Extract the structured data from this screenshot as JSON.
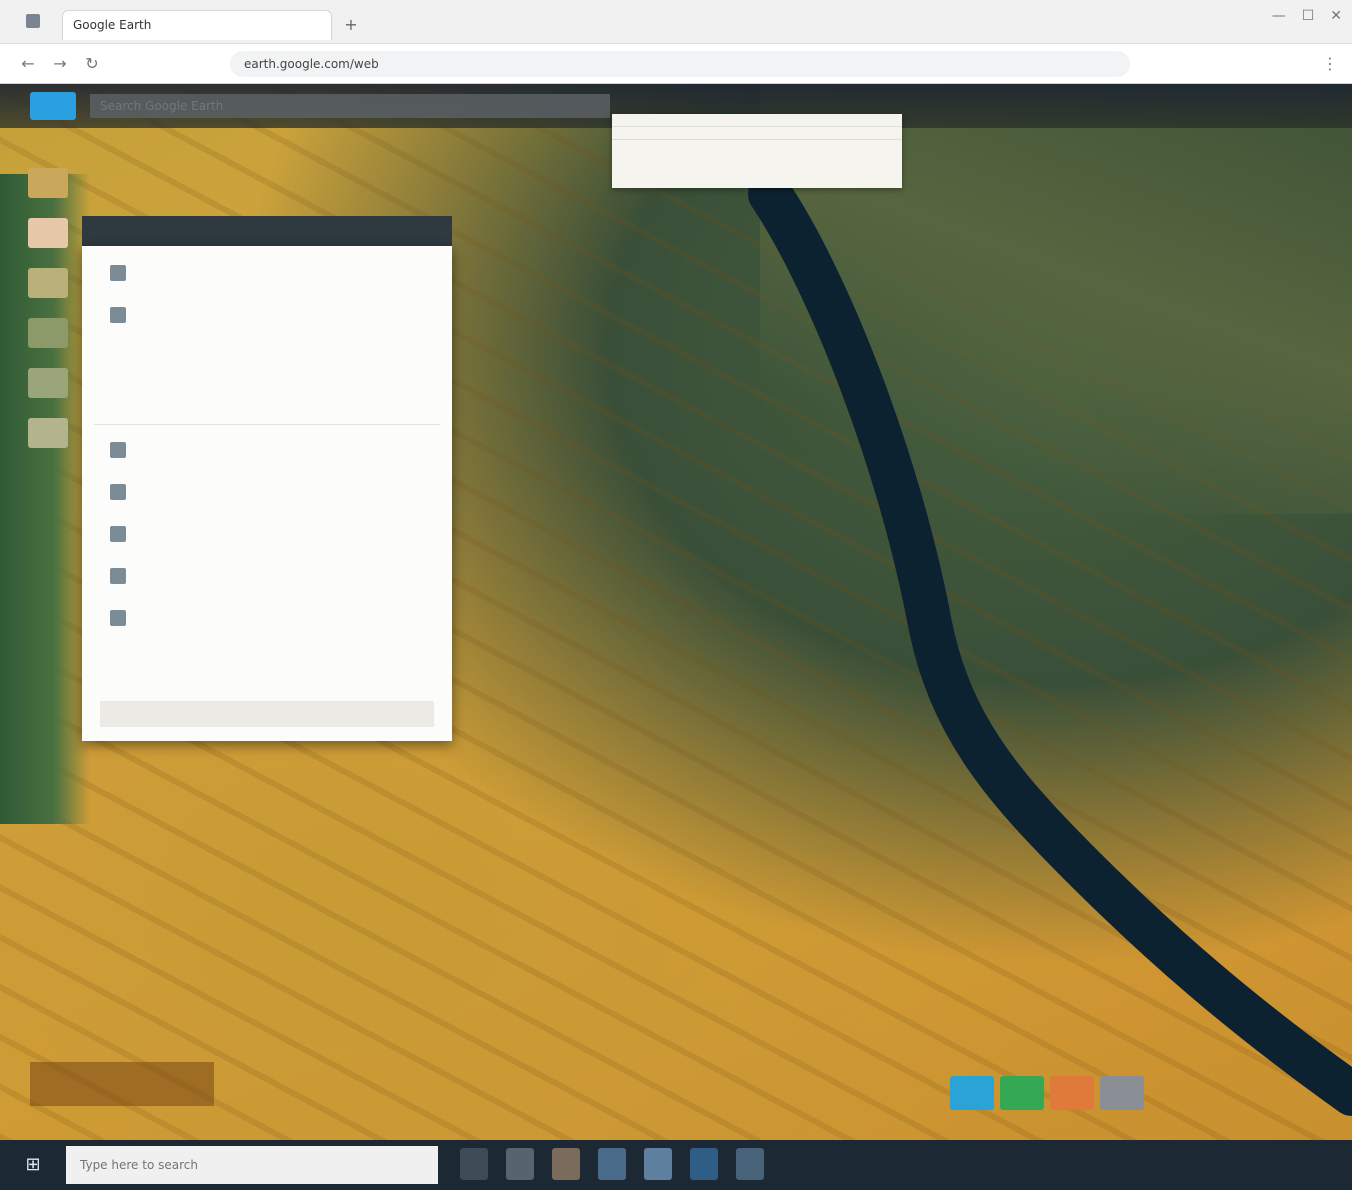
{
  "browser": {
    "tab_title": "Google Earth",
    "new_tab_symbol": "+",
    "url": "earth.google.com/web",
    "window_controls": {
      "minimize": "—",
      "maximize": "☐",
      "close": "✕"
    },
    "nav": {
      "back": "←",
      "forward": "→",
      "reload": "↻",
      "menu": "⋮"
    }
  },
  "earth": {
    "search_value": "",
    "search_placeholder": "Search Google Earth",
    "search_results": [
      "",
      ""
    ],
    "panel_title": "",
    "menu_items": [
      {
        "label": "",
        "hint": "",
        "icon": "item-icon"
      },
      {
        "label": "",
        "hint": "",
        "icon": "item-icon"
      },
      {
        "label": "",
        "hint": "",
        "icon": "blank"
      },
      {
        "label": "",
        "hint": "",
        "icon": "blank"
      },
      {
        "label": "",
        "hint": "",
        "icon": "item-icon"
      },
      {
        "label": "",
        "hint": "",
        "icon": "item-icon"
      },
      {
        "label": "",
        "hint": "",
        "icon": "item-icon"
      },
      {
        "label": "",
        "hint": "",
        "icon": "item-icon"
      },
      {
        "label": "",
        "hint": "",
        "icon": "item-icon"
      },
      {
        "label": "",
        "hint": "",
        "icon": "blank"
      }
    ],
    "menu_footer": "",
    "scale_text": "",
    "colors": {
      "toolbar": "#1e2630",
      "logo": "#2aa0e0",
      "river": "#0d2230",
      "fields": "#d9a33d",
      "forest": "#3e5237",
      "ctrl_blue": "#2aa3d6",
      "ctrl_green": "#34a853",
      "ctrl_orange": "#e07a3a",
      "ctrl_gray": "#8a8f95"
    }
  },
  "taskbar": {
    "start_symbol": "⊞",
    "search_placeholder": "Type here to search",
    "tray_text": ""
  }
}
